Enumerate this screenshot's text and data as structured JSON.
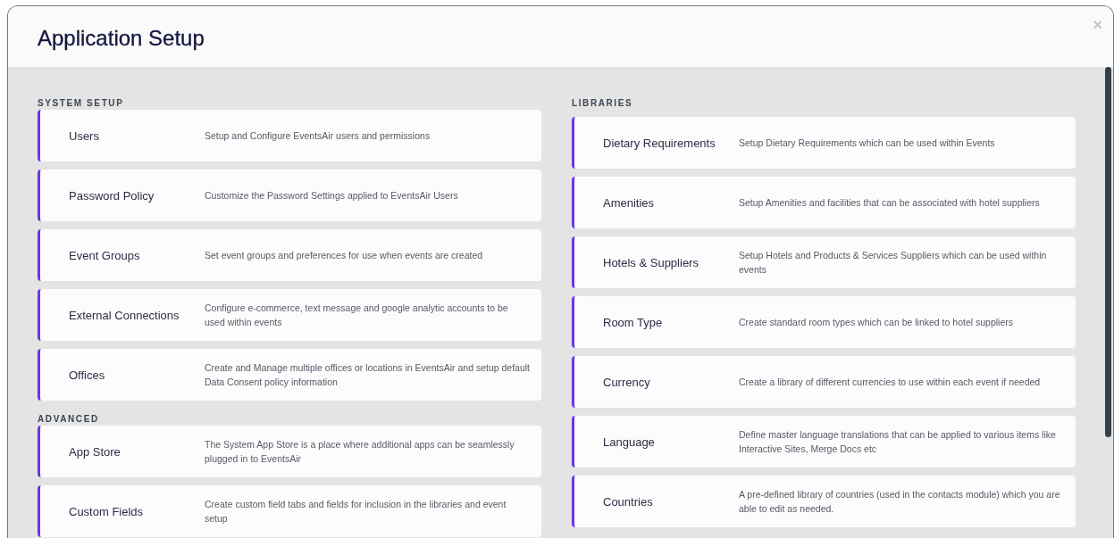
{
  "dialog": {
    "title": "Application Setup",
    "close": "×"
  },
  "columns": [
    [
      {
        "heading": "SYSTEM SETUP",
        "items": [
          {
            "name": "Users",
            "description": "Setup and Configure EventsAir users and permissions"
          },
          {
            "name": "Password Policy",
            "description": "Customize the Password Settings applied to EventsAir Users"
          },
          {
            "name": "Event Groups",
            "description": "Set event groups and preferences for use when events are created"
          },
          {
            "name": "External Connections",
            "description": "Configure e-commerce, text message and google analytic accounts to be used within events"
          },
          {
            "name": "Offices",
            "description": "Create and Manage multiple offices or locations in EventsAir and setup default Data Consent policy information"
          }
        ]
      },
      {
        "heading": "ADVANCED",
        "items": [
          {
            "name": "App Store",
            "description": "The System App Store is a place where additional apps can be seamlessly plugged in to EventsAir"
          },
          {
            "name": "Custom Fields",
            "description": "Create custom field tabs and fields for inclusion in the libraries and event setup"
          }
        ]
      }
    ],
    [
      {
        "heading": "LIBRARIES",
        "items": [
          {
            "name": "Dietary Requirements",
            "description": "Setup Dietary Requirements which can be used within Events"
          },
          {
            "name": "Amenities",
            "description": "Setup Amenities and facilities that can be associated with hotel suppliers"
          },
          {
            "name": "Hotels & Suppliers",
            "description": "Setup Hotels and Products & Services Suppliers which can be used within events"
          },
          {
            "name": "Room Type",
            "description": "Create standard room types which can be linked to hotel suppliers"
          },
          {
            "name": "Currency",
            "description": "Create a library of different currencies to use within each event if needed"
          },
          {
            "name": "Language",
            "description": "Define master language translations that can be applied to various items like Interactive Sites, Merge Docs etc"
          },
          {
            "name": "Countries",
            "description": "A pre-defined library of countries (used in the contacts module) which you are able to edit as needed."
          }
        ]
      }
    ]
  ]
}
